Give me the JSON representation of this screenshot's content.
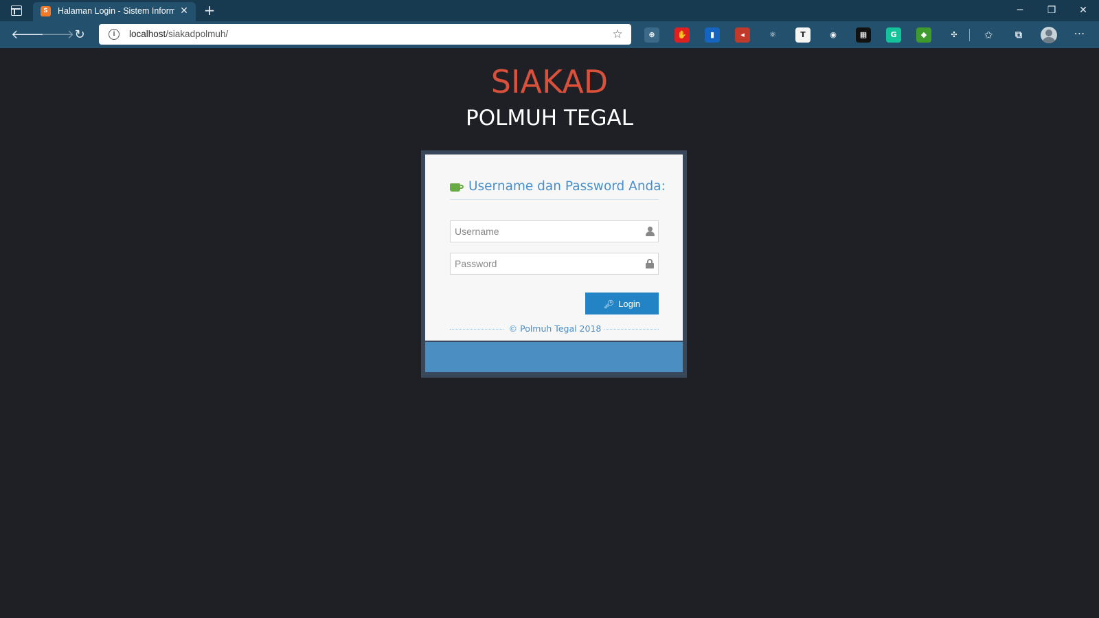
{
  "browser": {
    "tab_title": "Halaman Login - Sistem Informa",
    "tab_favicon_text": "S",
    "close_tab_glyph": "✕",
    "new_tab_glyph": "+",
    "url_host": "localhost",
    "url_path": "/siakadpolmuh/",
    "window_controls": {
      "minimize": "─",
      "maximize": "❐",
      "close": "✕"
    },
    "extensions": [
      {
        "name": "globe-extension-icon",
        "glyph": "⊕",
        "color": "#3a6a88"
      },
      {
        "name": "hand-extension-icon",
        "glyph": "✋",
        "color": "#e02020"
      },
      {
        "name": "chart-extension-icon",
        "glyph": "▮",
        "color": "#1565c0"
      },
      {
        "name": "mail-extension-icon",
        "glyph": "◂",
        "color": "#c0392b"
      },
      {
        "name": "react-extension-icon",
        "glyph": "⚛",
        "color": "#22506d"
      },
      {
        "name": "text-extension-icon",
        "glyph": "T",
        "color": "#f4f4f4"
      },
      {
        "name": "bulb-extension-icon",
        "glyph": "◉",
        "color": "#22506d"
      },
      {
        "name": "grid-extension-icon",
        "glyph": "▦",
        "color": "#111111"
      },
      {
        "name": "grammarly-extension-icon",
        "glyph": "G",
        "color": "#15c39a"
      },
      {
        "name": "map-extension-icon",
        "glyph": "◆",
        "color": "#3f9b2e"
      },
      {
        "name": "puzzle-extension-icon",
        "glyph": "✣",
        "color": "#22506d"
      }
    ]
  },
  "page": {
    "brand_title": "SIAKAD",
    "brand_subtitle": "POLMUH TEGAL",
    "login": {
      "header": "Username dan Password Anda:",
      "username_placeholder": "Username",
      "password_placeholder": "Password",
      "login_label": "Login",
      "copyright": "© Polmuh Tegal 2018"
    }
  },
  "colors": {
    "page_background": "#1e2026",
    "brand_title": "#d9513a",
    "accent_blue": "#2283c5",
    "header_text": "#478fca",
    "coffee_green": "#69aa46",
    "box_footer": "#4a8ec2"
  }
}
